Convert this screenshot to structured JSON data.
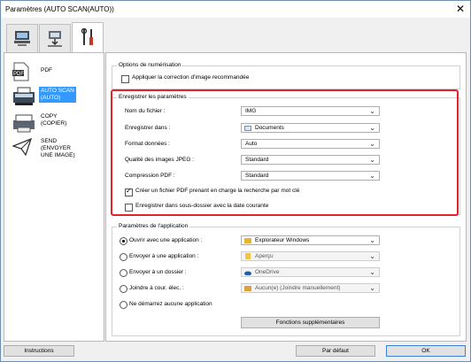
{
  "window": {
    "title": "Paramètres (AUTO SCAN(AUTO))",
    "close_glyph": "✕"
  },
  "tabs": [
    {
      "icon": "computer-scanner-icon",
      "active": false
    },
    {
      "icon": "scan-to-pc-icon",
      "active": false
    },
    {
      "icon": "tools-icon",
      "active": true
    }
  ],
  "nav": [
    {
      "label": "PDF",
      "icon": "pdf-icon"
    },
    {
      "label": "AUTO SCAN\n(AUTO)",
      "icon": "auto-scan-icon",
      "selected": true
    },
    {
      "label": "COPY\n(COPIER)",
      "icon": "copy-icon"
    },
    {
      "label": "SEND\n(ENVOYER\nUNE IMAGE)",
      "icon": "send-icon"
    }
  ],
  "scan_options": {
    "legend": "Options de numérisation",
    "apply_correction": {
      "label": "Appliquer la correction d'image recommandée",
      "checked": false
    }
  },
  "save_settings": {
    "legend": "Enregistrer les paramètres",
    "file_name": {
      "label": "Nom du fichier :",
      "value": "IMG"
    },
    "save_in": {
      "label": "Enregistrer dans :",
      "value": "Documents"
    },
    "data_format": {
      "label": "Format données :",
      "value": "Auto"
    },
    "jpeg_quality": {
      "label": "Qualité des images JPEG :",
      "value": "Standard"
    },
    "pdf_compression": {
      "label": "Compression PDF :",
      "value": "Standard"
    },
    "searchable_pdf": {
      "label": "Créer un fichier PDF prenant en charge la recherche par mot clé",
      "checked": true
    },
    "subfolder_date": {
      "label": "Enregistrer dans sous-dossier avec la date courante",
      "checked": false
    }
  },
  "app_settings": {
    "legend": "Paramètres de l'application",
    "options": [
      {
        "label": "Ouvrir avec une application :",
        "value": "Explorateur Windows",
        "checked": true,
        "enabled": true
      },
      {
        "label": "Envoyer à une application :",
        "value": "Aperçu",
        "checked": false,
        "enabled": false
      },
      {
        "label": "Envoyer à un dossier :",
        "value": "OneDrive",
        "checked": false,
        "enabled": false
      },
      {
        "label": "Joindre à cour. élec. :",
        "value": "Aucun(e) (Joindre manuellement)",
        "checked": false,
        "enabled": false
      },
      {
        "label": "Ne démarrez aucune application",
        "checked": false
      }
    ],
    "more_functions": "Fonctions supplémentaires"
  },
  "footer": {
    "instructions": "Instructions",
    "default": "Par défaut",
    "ok": "OK"
  },
  "colors": {
    "highlight": "#e8202a",
    "selection": "#3399ff"
  }
}
